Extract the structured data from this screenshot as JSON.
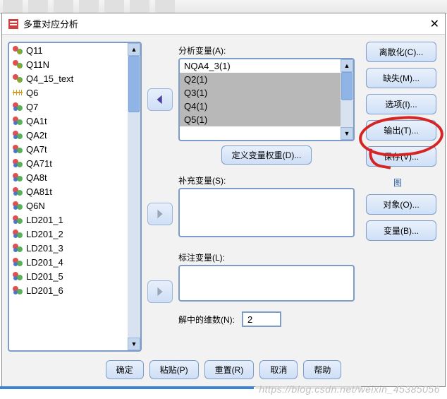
{
  "window": {
    "title": "多重对应分析"
  },
  "left_vars": [
    {
      "name": "Q11",
      "icon": "nom-a"
    },
    {
      "name": "Q11N",
      "icon": "nom-a"
    },
    {
      "name": "Q4_15_text",
      "icon": "nom-a"
    },
    {
      "name": "Q6",
      "icon": "scale"
    },
    {
      "name": "Q7",
      "icon": "nom"
    },
    {
      "name": "QA1t",
      "icon": "nom"
    },
    {
      "name": "QA2t",
      "icon": "nom"
    },
    {
      "name": "QA7t",
      "icon": "nom"
    },
    {
      "name": "QA71t",
      "icon": "nom"
    },
    {
      "name": "QA8t",
      "icon": "nom"
    },
    {
      "name": "QA81t",
      "icon": "nom"
    },
    {
      "name": "Q6N",
      "icon": "nom"
    },
    {
      "name": "LD201_1",
      "icon": "nom"
    },
    {
      "name": "LD201_2",
      "icon": "nom"
    },
    {
      "name": "LD201_3",
      "icon": "nom"
    },
    {
      "name": "LD201_4",
      "icon": "nom"
    },
    {
      "name": "LD201_5",
      "icon": "nom"
    },
    {
      "name": "LD201_6",
      "icon": "nom"
    }
  ],
  "labels": {
    "analysis_vars": "分析变量(A):",
    "define_weight": "定义变量权重(D)...",
    "supplementary": "补充变量(S):",
    "label_vars": "标注变量(L):",
    "dimensions": "解中的维数(N):",
    "group": "图"
  },
  "analysis_list": [
    {
      "name": "NQA4_3(1)",
      "sel": false
    },
    {
      "name": "Q2(1)",
      "sel": true
    },
    {
      "name": "Q3(1)",
      "sel": true
    },
    {
      "name": "Q4(1)",
      "sel": true
    },
    {
      "name": "Q5(1)",
      "sel": true
    }
  ],
  "dimensions_value": "2",
  "side_buttons": {
    "discretize": "离散化(C)...",
    "missing": "缺失(M)...",
    "options": "选项(I)...",
    "output": "输出(T)...",
    "save": "保存(V)...",
    "object": "对象(O)...",
    "variable": "变量(B)..."
  },
  "bottom": {
    "ok": "确定",
    "paste": "粘贴(P)",
    "reset": "重置(R)",
    "cancel": "取消",
    "help": "帮助"
  },
  "watermark": "https://blog.csdn.net/weixin_45385056"
}
